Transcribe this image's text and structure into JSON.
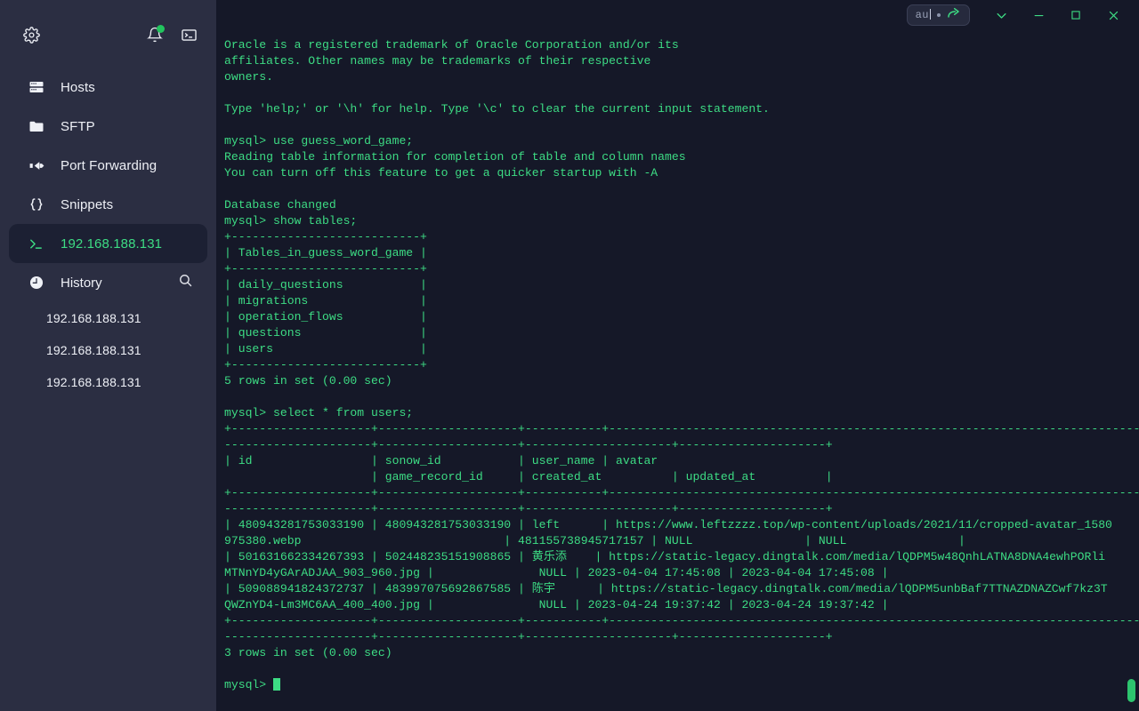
{
  "window": {
    "tag_pill": {
      "text": "au",
      "icon": "share-arrow-icon"
    },
    "controls": {
      "chevron_down": "chevron-down-icon",
      "minimize": "minimize-icon",
      "maximize": "maximize-icon",
      "close": "close-icon"
    }
  },
  "sidebar": {
    "toolbar": {
      "settings": "gear-icon",
      "notifications": "bell-icon",
      "terminal": "terminal-icon"
    },
    "items": [
      {
        "label": "Hosts",
        "icon": "server-icon",
        "active": false
      },
      {
        "label": "SFTP",
        "icon": "folder-icon",
        "active": false
      },
      {
        "label": "Port Forwarding",
        "icon": "port-forward-icon",
        "active": false
      },
      {
        "label": "Snippets",
        "icon": "braces-icon",
        "active": false
      },
      {
        "label": "192.168.188.131",
        "icon": "terminal-prompt-icon",
        "active": true
      }
    ],
    "history": {
      "label": "History",
      "icon": "clock-icon",
      "search_icon": "search-icon",
      "items": [
        "192.168.188.131",
        "192.168.188.131",
        "192.168.188.131"
      ]
    }
  },
  "terminal": {
    "prompt": "mysql> ",
    "accent_color": "#3ddc84",
    "background_color": "#151828",
    "lines": [
      "Oracle is a registered trademark of Oracle Corporation and/or its",
      "affiliates. Other names may be trademarks of their respective",
      "owners.",
      "",
      "Type 'help;' or '\\h' for help. Type '\\c' to clear the current input statement.",
      "",
      "mysql> use guess_word_game;",
      "Reading table information for completion of table and column names",
      "You can turn off this feature to get a quicker startup with -A",
      "",
      "Database changed",
      "mysql> show tables;",
      "+---------------------------+",
      "| Tables_in_guess_word_game |",
      "+---------------------------+",
      "| daily_questions           |",
      "| migrations                |",
      "| operation_flows           |",
      "| questions                 |",
      "| users                     |",
      "+---------------------------+",
      "5 rows in set (0.00 sec)",
      "",
      "mysql> select * from users;",
      "+--------------------+--------------------+-----------+-----------------------------------------------------------------------------------",
      "---------------------+--------------------+---------------------+---------------------+",
      "| id                 | sonow_id           | user_name | avatar",
      "                     | game_record_id     | created_at          | updated_at          |",
      "+--------------------+--------------------+-----------+-----------------------------------------------------------------------------------",
      "---------------------+--------------------+---------------------+---------------------+",
      "| 480943281753033190 | 480943281753033190 | left      | https://www.leftzzzz.top/wp-content/uploads/2021/11/cropped-avatar_1580",
      "975380.webp                             | 481155738945717157 | NULL                | NULL                |",
      "| 501631662334267393 | 502448235151908865 | 黄乐添    | https://static-legacy.dingtalk.com/media/lQDPM5w48QnhLATNA8DNA4ewhPORli",
      "MTNnYD4yGArADJAA_903_960.jpg |               NULL | 2023-04-04 17:45:08 | 2023-04-04 17:45:08 |",
      "| 509088941824372737 | 483997075692867585 | 陈宇      | https://static-legacy.dingtalk.com/media/lQDPM5unbBaf7TTNAZDNAZCwf7kz3T",
      "QWZnYD4-Lm3MC6AA_400_400.jpg |               NULL | 2023-04-24 19:37:42 | 2023-04-24 19:37:42 |",
      "+--------------------+--------------------+-----------+-----------------------------------------------------------------------------------",
      "---------------------+--------------------+---------------------+---------------------+",
      "3 rows in set (0.00 sec)",
      ""
    ],
    "result_tables": {
      "show_tables": {
        "header": "Tables_in_guess_word_game",
        "rows": [
          "daily_questions",
          "migrations",
          "operation_flows",
          "questions",
          "users"
        ],
        "footer": "5 rows in set (0.00 sec)"
      },
      "select_users": {
        "columns": [
          "id",
          "sonow_id",
          "user_name",
          "avatar",
          "game_record_id",
          "created_at",
          "updated_at"
        ],
        "rows": [
          {
            "id": "480943281753033190",
            "sonow_id": "480943281753033190",
            "user_name": "left",
            "avatar": "https://www.leftzzzz.top/wp-content/uploads/2021/11/cropped-avatar_1580975380.webp",
            "game_record_id": "481155738945717157",
            "created_at": "NULL",
            "updated_at": "NULL"
          },
          {
            "id": "501631662334267393",
            "sonow_id": "502448235151908865",
            "user_name": "黄乐添",
            "avatar": "https://static-legacy.dingtalk.com/media/lQDPM5w48QnhLATNA8DNA4ewhPORliMTNnYD4yGArADJAA_903_960.jpg",
            "game_record_id": "NULL",
            "created_at": "2023-04-04 17:45:08",
            "updated_at": "2023-04-04 17:45:08"
          },
          {
            "id": "509088941824372737",
            "sonow_id": "483997075692867585",
            "user_name": "陈宇",
            "avatar": "https://static-legacy.dingtalk.com/media/lQDPM5unbBaf7TTNAZDNAZCwf7kz3TQWZnYD4-Lm3MC6AA_400_400.jpg",
            "game_record_id": "NULL",
            "created_at": "2023-04-24 19:37:42",
            "updated_at": "2023-04-24 19:37:42"
          }
        ],
        "footer": "3 rows in set (0.00 sec)"
      }
    }
  }
}
